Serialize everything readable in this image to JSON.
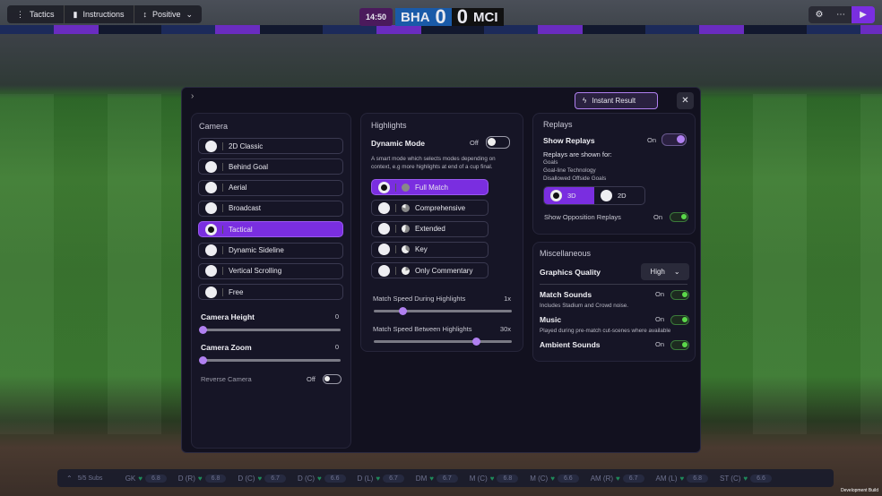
{
  "topbar": {
    "tactics": "Tactics",
    "instructions": "Instructions",
    "mentality": "Positive"
  },
  "scoreboard": {
    "clock": "14:50",
    "home": "BHA",
    "home_score": "0",
    "away_score": "0",
    "away": "MCI"
  },
  "modal": {
    "instant_result": "Instant Result",
    "camera": {
      "title": "Camera",
      "options": [
        "2D Classic",
        "Behind Goal",
        "Aerial",
        "Broadcast",
        "Tactical",
        "Dynamic Sideline",
        "Vertical Scrolling",
        "Free"
      ],
      "selected": "Tactical",
      "height_label": "Camera Height",
      "height_value": "0",
      "height_fraction": 0,
      "zoom_label": "Camera Zoom",
      "zoom_value": "0",
      "zoom_fraction": 0,
      "reverse_label": "Reverse Camera",
      "reverse_state": "Off"
    },
    "highlights": {
      "title": "Highlights",
      "dynamic_label": "Dynamic Mode",
      "dynamic_state": "Off",
      "dynamic_desc": "A smart mode which selects modes depending on context, e.g more highlights at end of a cup final.",
      "options": [
        "Full Match",
        "Comprehensive",
        "Extended",
        "Key",
        "Only Commentary"
      ],
      "selected": "Full Match",
      "speed_during_label": "Match Speed During Highlights",
      "speed_during_value": "1x",
      "speed_during_fraction": 0.21,
      "speed_between_label": "Match Speed Between Highlights",
      "speed_between_value": "30x",
      "speed_between_fraction": 0.74
    },
    "replays": {
      "title": "Replays",
      "show_label": "Show Replays",
      "show_state": "On",
      "shown_for": "Replays are shown for:",
      "list": [
        "Goals",
        "Goal-line Technology",
        "Disallowed Offside Goals"
      ],
      "mode_3d": "3D",
      "mode_2d": "2D",
      "opp_label": "Show Opposition Replays",
      "opp_state": "On"
    },
    "misc": {
      "title": "Miscellaneous",
      "gq_label": "Graphics Quality",
      "gq_value": "High",
      "match_sounds": "Match Sounds",
      "match_sounds_state": "On",
      "match_sounds_desc": "Includes Stadium and Crowd noise.",
      "music": "Music",
      "music_state": "On",
      "music_desc": "Played during pre-match cut-scenes where available",
      "ambient": "Ambient Sounds",
      "ambient_state": "On"
    }
  },
  "bottom": {
    "subs": "5/5 Subs",
    "players": [
      {
        "pos": "GK",
        "rating": "6.8"
      },
      {
        "pos": "D (R)",
        "rating": "6.8"
      },
      {
        "pos": "D (C)",
        "rating": "6.7"
      },
      {
        "pos": "D (C)",
        "rating": "6.6"
      },
      {
        "pos": "D (L)",
        "rating": "6.7"
      },
      {
        "pos": "DM",
        "rating": "6.7"
      },
      {
        "pos": "M (C)",
        "rating": "6.8"
      },
      {
        "pos": "M (C)",
        "rating": "6.6"
      },
      {
        "pos": "AM (R)",
        "rating": "6.7"
      },
      {
        "pos": "AM (L)",
        "rating": "6.8"
      },
      {
        "pos": "ST (C)",
        "rating": "6.6"
      }
    ]
  },
  "build_label": "Development Build",
  "colors": {
    "accent": "#7a2ee0",
    "toggle_on": "#5ad84a",
    "modal_bg": "#12111f"
  }
}
